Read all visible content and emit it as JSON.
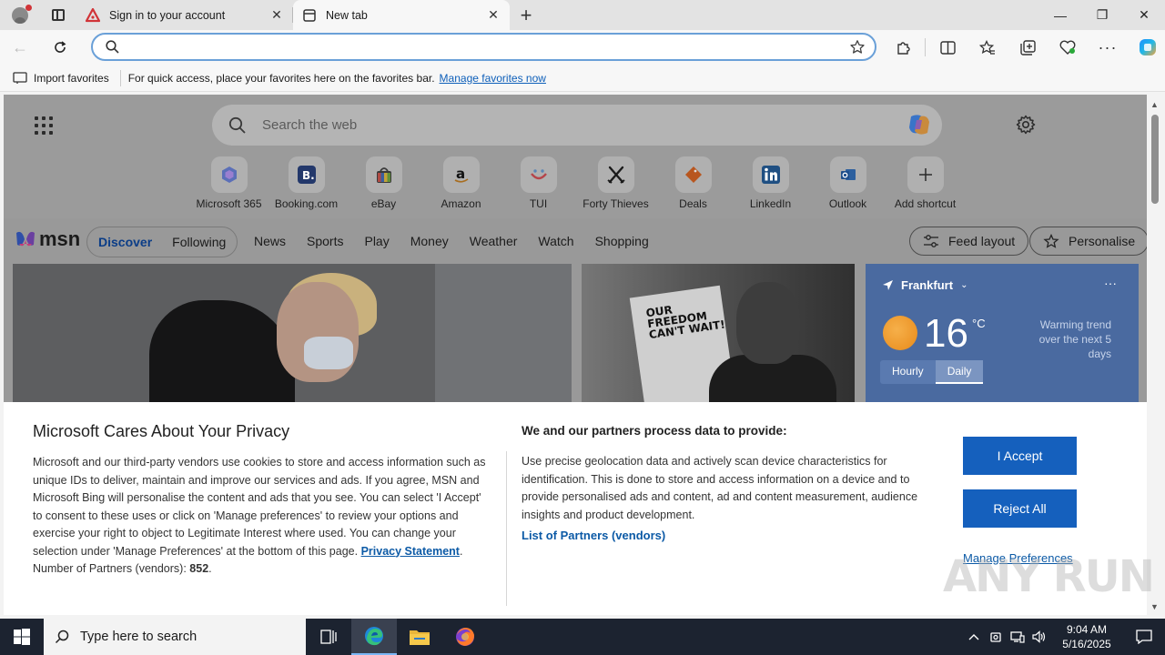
{
  "browser": {
    "tabs": [
      {
        "title": "Sign in to your account",
        "active": false
      },
      {
        "title": "New tab",
        "active": true
      }
    ],
    "address": {
      "value": "",
      "placeholder": ""
    },
    "favorites_bar": {
      "import_label": "Import favorites",
      "message": "For quick access, place your favorites here on the favorites bar.",
      "manage_link": "Manage favorites now"
    }
  },
  "newtab": {
    "search_placeholder": "Search the web",
    "shortcuts": [
      {
        "label": "Microsoft 365",
        "icon": "microsoft-365-icon"
      },
      {
        "label": "Booking.com",
        "icon": "booking-icon"
      },
      {
        "label": "eBay",
        "icon": "ebay-icon"
      },
      {
        "label": "Amazon",
        "icon": "amazon-icon"
      },
      {
        "label": "TUI",
        "icon": "tui-icon"
      },
      {
        "label": "Forty Thieves",
        "icon": "forty-thieves-icon"
      },
      {
        "label": "Deals",
        "icon": "deals-icon"
      },
      {
        "label": "LinkedIn",
        "icon": "linkedin-icon"
      },
      {
        "label": "Outlook",
        "icon": "outlook-icon"
      },
      {
        "label": "Add shortcut",
        "icon": "plus-icon"
      }
    ],
    "msn": {
      "logo": "msn",
      "pill_tabs": [
        "Discover",
        "Following"
      ],
      "nav": [
        "News",
        "Sports",
        "Play",
        "Money",
        "Weather",
        "Watch",
        "Shopping"
      ],
      "feed_layout": "Feed layout",
      "personalise": "Personalise"
    },
    "card2_headline": "OUR FREEDOM CAN'T WAIT!",
    "weather": {
      "city": "Frankfurt",
      "temp": "16",
      "unit": "°C",
      "trend_line1": "Warming trend",
      "trend_line2": "over the next 5 days",
      "tab_hourly": "Hourly",
      "tab_daily": "Daily"
    }
  },
  "privacy": {
    "title": "Microsoft Cares About Your Privacy",
    "body": "Microsoft and our third-party vendors use cookies to store and access information such as unique IDs to deliver, maintain and improve our services and ads. If you agree, MSN and Microsoft Bing will personalise the content and ads that you see. You can select 'I Accept' to consent to these uses or click on 'Manage preferences' to review your options and exercise your right to object to Legitimate Interest where used.  You can change your selection under 'Manage Preferences' at the bottom of this page.",
    "privacy_link": "Privacy Statement",
    "partners_label": "Number of Partners (vendors):",
    "partners_count": "852",
    "right_title": "We and our partners process data to provide:",
    "right_body": "Use precise geolocation data and actively scan device characteristics for identification. This is done to store and access information on a device and to provide personalised ads and content, ad and content measurement, audience insights and product development.",
    "list_partners": "List of Partners (vendors)",
    "accept": "I Accept",
    "reject": "Reject All",
    "manage": "Manage Preferences"
  },
  "watermark": "ANY RUN",
  "taskbar": {
    "search_placeholder": "Type here to search",
    "time": "9:04 AM",
    "date": "5/16/2025"
  },
  "colors": {
    "accent": "#1560bd",
    "link": "#0c5aa6",
    "taskbar": "#1c2330"
  }
}
